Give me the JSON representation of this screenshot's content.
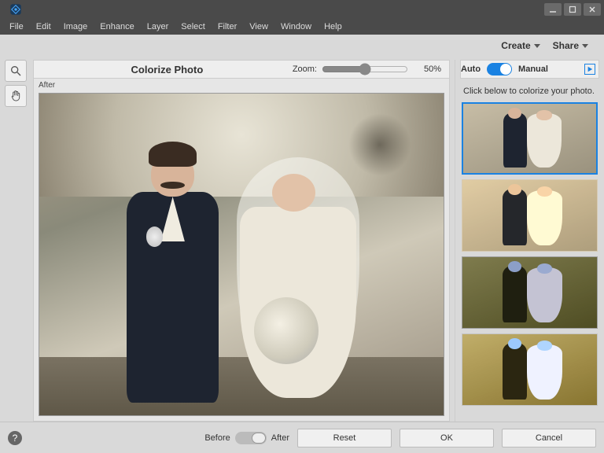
{
  "menu": [
    "File",
    "Edit",
    "Image",
    "Enhance",
    "Layer",
    "Select",
    "Filter",
    "View",
    "Window",
    "Help"
  ],
  "topactions": {
    "create": "Create",
    "share": "Share"
  },
  "canvas": {
    "title": "Colorize Photo",
    "zoom_label": "Zoom:",
    "zoom_value": "50%",
    "view_label": "After"
  },
  "panel": {
    "auto": "Auto",
    "manual": "Manual",
    "hint": "Click below to colorize your photo."
  },
  "bottom": {
    "before": "Before",
    "after": "After",
    "reset": "Reset",
    "ok": "OK",
    "cancel": "Cancel"
  }
}
